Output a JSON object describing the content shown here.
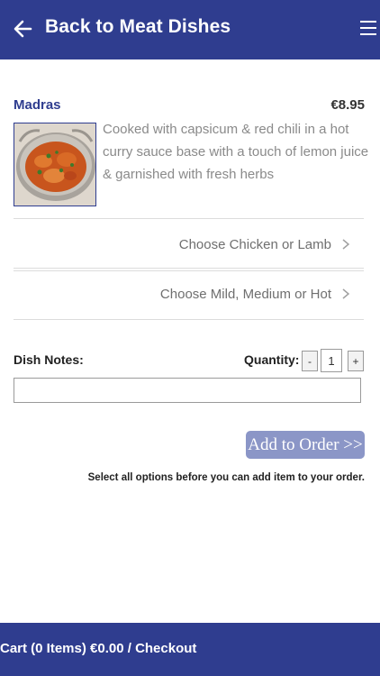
{
  "header": {
    "back_icon": "arrow-left-icon",
    "title": "Back to Meat Dishes",
    "menu_icon": "hamburger-menu-icon"
  },
  "dish": {
    "name": "Madras",
    "price": "€8.95",
    "image": "curry-dish-photo",
    "description": "Cooked with capsicum & red chili in a hot curry sauce base with a touch of lemon juice & garnished with fresh herbs"
  },
  "options": [
    {
      "label": "Choose Chicken or Lamb",
      "icon": "chevron-right-icon"
    },
    {
      "label": "Choose Mild, Medium or Hot",
      "icon": "chevron-right-icon"
    }
  ],
  "order": {
    "notes_label": "Dish Notes:",
    "notes_value": "",
    "quantity_label": "Quantity:",
    "decrement_label": "-",
    "increment_label": "+",
    "quantity_value": "1",
    "add_button_label": "Add to Order >>",
    "hint": "Select all options before you can add item to your order."
  },
  "footer": {
    "cart_label": "Cart (0 Items) €0.00 / Checkout"
  },
  "colors": {
    "brand": "#2f3d8f",
    "add_button": "#8b96c7",
    "description_text": "#8a8a8a"
  }
}
